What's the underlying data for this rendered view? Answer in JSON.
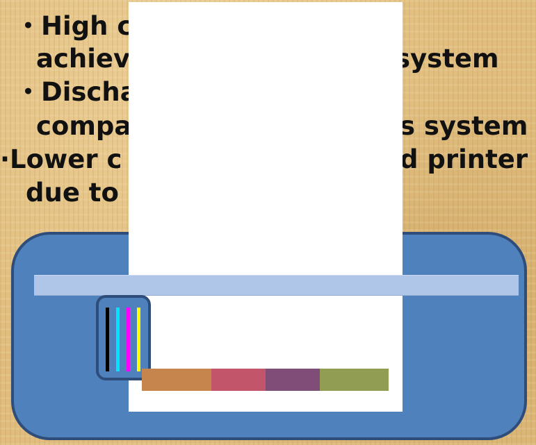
{
  "text_lines": [
    "・High c",
    "achiev",
    "system",
    "・Discha",
    "compa",
    "s system",
    "·Lower c",
    "d printer",
    "due to"
  ],
  "ink_colors": [
    "#000000",
    "#00e5ff",
    "#ff00ff",
    "#ffff00"
  ],
  "output_swatches": [
    "#c5854c",
    "#c3556a",
    "#804d79",
    "#919d52"
  ],
  "colors": {
    "printer_body": "#4f81bd",
    "printer_border": "#2f4d7a",
    "rail": "#b0c6e8",
    "paper": "#ffffff",
    "background": "#e0bd7e"
  }
}
